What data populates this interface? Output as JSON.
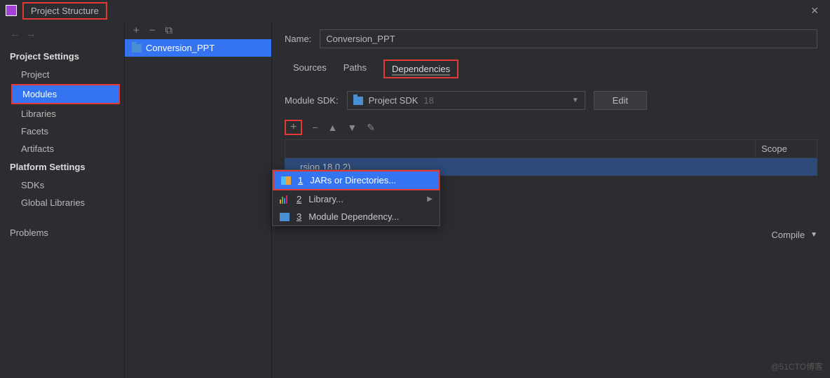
{
  "window": {
    "title": "Project Structure"
  },
  "sidebar": {
    "sections": [
      {
        "header": "Project Settings",
        "items": [
          {
            "label": "Project"
          },
          {
            "label": "Modules",
            "selected": true
          },
          {
            "label": "Libraries"
          },
          {
            "label": "Facets"
          },
          {
            "label": "Artifacts"
          }
        ]
      },
      {
        "header": "Platform Settings",
        "items": [
          {
            "label": "SDKs"
          },
          {
            "label": "Global Libraries"
          }
        ]
      }
    ],
    "problems": "Problems"
  },
  "modules": {
    "list": [
      {
        "name": "Conversion_PPT",
        "selected": true
      }
    ]
  },
  "content": {
    "name_label": "Name:",
    "name_value": "Conversion_PPT",
    "tabs": [
      {
        "label": "Sources"
      },
      {
        "label": "Paths"
      },
      {
        "label": "Dependencies",
        "active": true
      }
    ],
    "sdk_label": "Module SDK:",
    "sdk_value": "Project SDK",
    "sdk_version": "18",
    "edit_label": "Edit",
    "deps_header": {
      "scope": "Scope"
    },
    "deps_rows": [
      {
        "text": "rsion 18.0.2)"
      }
    ],
    "compile_label": "Compile"
  },
  "popup": {
    "items": [
      {
        "num": "1",
        "label": "JARs or Directories...",
        "icon": "jar",
        "selected": true
      },
      {
        "num": "2",
        "label": "Library...",
        "icon": "lib",
        "has_submenu": true
      },
      {
        "num": "3",
        "label": "Module Dependency...",
        "icon": "mod"
      }
    ]
  },
  "watermark": "@51CTO博客"
}
